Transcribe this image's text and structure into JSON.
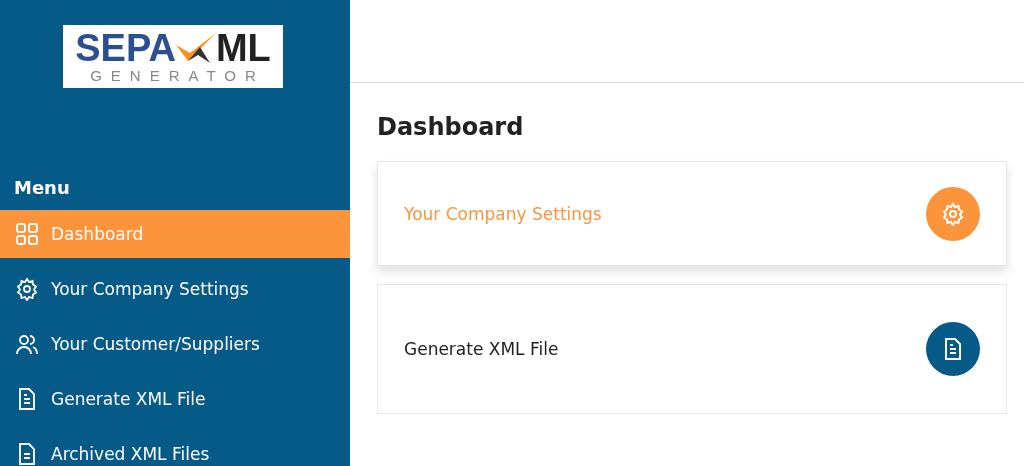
{
  "logo": {
    "word_left": "SEPA",
    "word_right": "ML",
    "tagline": "GENERATOR"
  },
  "sidebar": {
    "heading": "Menu",
    "items": [
      {
        "label": "Dashboard",
        "kind": "grid",
        "selected": true
      },
      {
        "label": "Your Company Settings",
        "kind": "gear",
        "selected": false
      },
      {
        "label": "Your Customer/Suppliers",
        "kind": "people",
        "selected": false
      },
      {
        "label": "Generate XML File",
        "kind": "document",
        "selected": false
      },
      {
        "label": "Archived XML Files",
        "kind": "archive",
        "selected": false
      }
    ]
  },
  "page": {
    "title": "Dashboard",
    "cards": [
      {
        "label": "Your Company Settings",
        "kind": "gear",
        "highlighted": true
      },
      {
        "label": "Generate XML File",
        "kind": "document",
        "highlighted": false
      }
    ]
  }
}
